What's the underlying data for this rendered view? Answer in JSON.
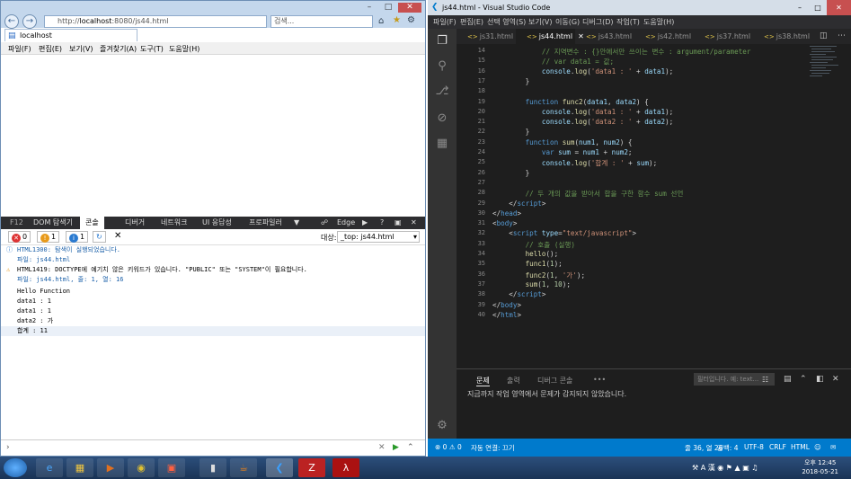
{
  "ie": {
    "address": {
      "prefix": "http://",
      "host": "localhost",
      "rest": ":8080/js44.html"
    },
    "search_placeholder": "검색...",
    "tab_title": "localhost",
    "menu": [
      "파일(F)",
      "편집(E)",
      "보기(V)",
      "즐겨찾기(A)",
      "도구(T)",
      "도움말(H)"
    ],
    "f12": {
      "label": "F12",
      "tabs": [
        "DOM 탐색기",
        "콘솔",
        "디버거",
        "네트워크",
        "UI 응답성",
        "프로파일러"
      ],
      "active_tab": "콘솔",
      "engine": "Edge",
      "errors": "0",
      "warnings": "1",
      "infos": "1",
      "target_label": "대상:",
      "target_value": "_top: js44.html",
      "console": [
        {
          "text": "HTML1300: 탐색이 실행되었습니다.",
          "type": "info"
        },
        {
          "text": "파일: js44.html",
          "type": "sub"
        },
        {
          "text": "HTML1419: DOCTYPE에 예기치 않은 키워드가 있습니다. \"PUBLIC\" 또는 \"SYSTEM\"이 필요합니다.",
          "type": "warn"
        },
        {
          "text": "파일: js44.html, 줄: 1, 열: 16",
          "type": "sub"
        },
        {
          "text": "Hello Function",
          "type": "log"
        },
        {
          "text": "data1 : 1",
          "type": "log"
        },
        {
          "text": "data1 : 1",
          "type": "log"
        },
        {
          "text": "data2 : 가",
          "type": "log"
        },
        {
          "text": "합계 : 11",
          "type": "log"
        }
      ]
    }
  },
  "vscode": {
    "title": "js44.html - Visual Studio Code",
    "menu": [
      "파일(F)",
      "편집(E)",
      "선택 영역(S)",
      "보기(V)",
      "이동(G)",
      "디버그(D)",
      "작업(T)",
      "도움말(H)"
    ],
    "tabs": [
      "js31.html",
      "js44.html",
      "js43.html",
      "js42.html",
      "js37.html",
      "js38.html"
    ],
    "active_tab": "js44.html",
    "lines": [
      {
        "n": "14",
        "html": "            <span class='cm'>// 지역변수 : {}안에서만 쓰이는 변수 : argument/parameter</span>"
      },
      {
        "n": "15",
        "html": "            <span class='cm'>// var data1 = 값;</span>"
      },
      {
        "n": "16",
        "html": "            <span class='var'>console</span>.<span class='fn'>log</span>(<span class='str'>'data1 : '</span> + <span class='var'>data1</span>);"
      },
      {
        "n": "17",
        "html": "        }"
      },
      {
        "n": "18",
        "html": ""
      },
      {
        "n": "19",
        "html": "        <span class='kw'>function</span> <span class='fn'>func2</span>(<span class='var'>data1</span>, <span class='var'>data2</span>) {"
      },
      {
        "n": "20",
        "html": "            <span class='var'>console</span>.<span class='fn'>log</span>(<span class='str'>'data1 : '</span> + <span class='var'>data1</span>);"
      },
      {
        "n": "21",
        "html": "            <span class='var'>console</span>.<span class='fn'>log</span>(<span class='str'>'data2 : '</span> + <span class='var'>data2</span>);"
      },
      {
        "n": "22",
        "html": "        }"
      },
      {
        "n": "23",
        "html": "        <span class='kw'>function</span> <span class='fn'>sum</span>(<span class='var'>num1</span>, <span class='var'>num2</span>) {"
      },
      {
        "n": "24",
        "html": "            <span class='kw'>var</span> <span class='var'>sum</span> = <span class='var'>num1</span> + <span class='var'>num2</span>;"
      },
      {
        "n": "25",
        "html": "            <span class='var'>console</span>.<span class='fn'>log</span>(<span class='str'>'합계 : '</span> + <span class='var'>sum</span>);"
      },
      {
        "n": "26",
        "html": "        }"
      },
      {
        "n": "27",
        "html": ""
      },
      {
        "n": "28",
        "html": "        <span class='cm'>// 두 개의 값을 받아서 합을 구한 함수 sum 선언</span>"
      },
      {
        "n": "29",
        "html": "    &lt;/<span class='tag'>script</span>&gt;"
      },
      {
        "n": "30",
        "html": "&lt;/<span class='tag'>head</span>&gt;"
      },
      {
        "n": "31",
        "html": "&lt;<span class='tag'>body</span>&gt;"
      },
      {
        "n": "32",
        "html": "    &lt;<span class='tag'>script</span> <span class='attr'>type</span>=<span class='str'>\"text/javascript\"</span>&gt;"
      },
      {
        "n": "33",
        "html": "        <span class='cm'>// 호출 (실행)</span>"
      },
      {
        "n": "34",
        "html": "        <span class='fn'>hello</span>();"
      },
      {
        "n": "35",
        "html": "        <span class='fn'>func1</span>(<span class='num'>1</span>);"
      },
      {
        "n": "36",
        "html": "        <span class='fn'>func2</span>(<span class='num'>1</span>, <span class='str'>'가'</span>);"
      },
      {
        "n": "37",
        "html": "        <span class='fn'>sum</span>(<span class='num'>1</span>, <span class='num'>10</span>);"
      },
      {
        "n": "38",
        "html": "    &lt;/<span class='tag'>script</span>&gt;"
      },
      {
        "n": "39",
        "html": "&lt;/<span class='tag'>body</span>&gt;"
      },
      {
        "n": "40",
        "html": "&lt;/<span class='tag'>html</span>&gt;"
      }
    ],
    "panel": {
      "tabs": [
        "문제",
        "출력",
        "디버그 콘솔",
        "•••"
      ],
      "active": "문제",
      "filter_placeholder": "필터입니다. 예: text...",
      "message": "지금까지 작업 영역에서 문제가 감지되지 않았습니다."
    },
    "status": {
      "errors": "0",
      "warnings": "0",
      "autosave": "자동 연결: 끄기",
      "position": "줄 36, 열 26",
      "spaces": "공백: 4",
      "encoding": "UTF-8",
      "eol": "CRLF",
      "language": "HTML"
    }
  },
  "taskbar": {
    "ampm": "오후 12:45",
    "date": "2018-05-21"
  }
}
